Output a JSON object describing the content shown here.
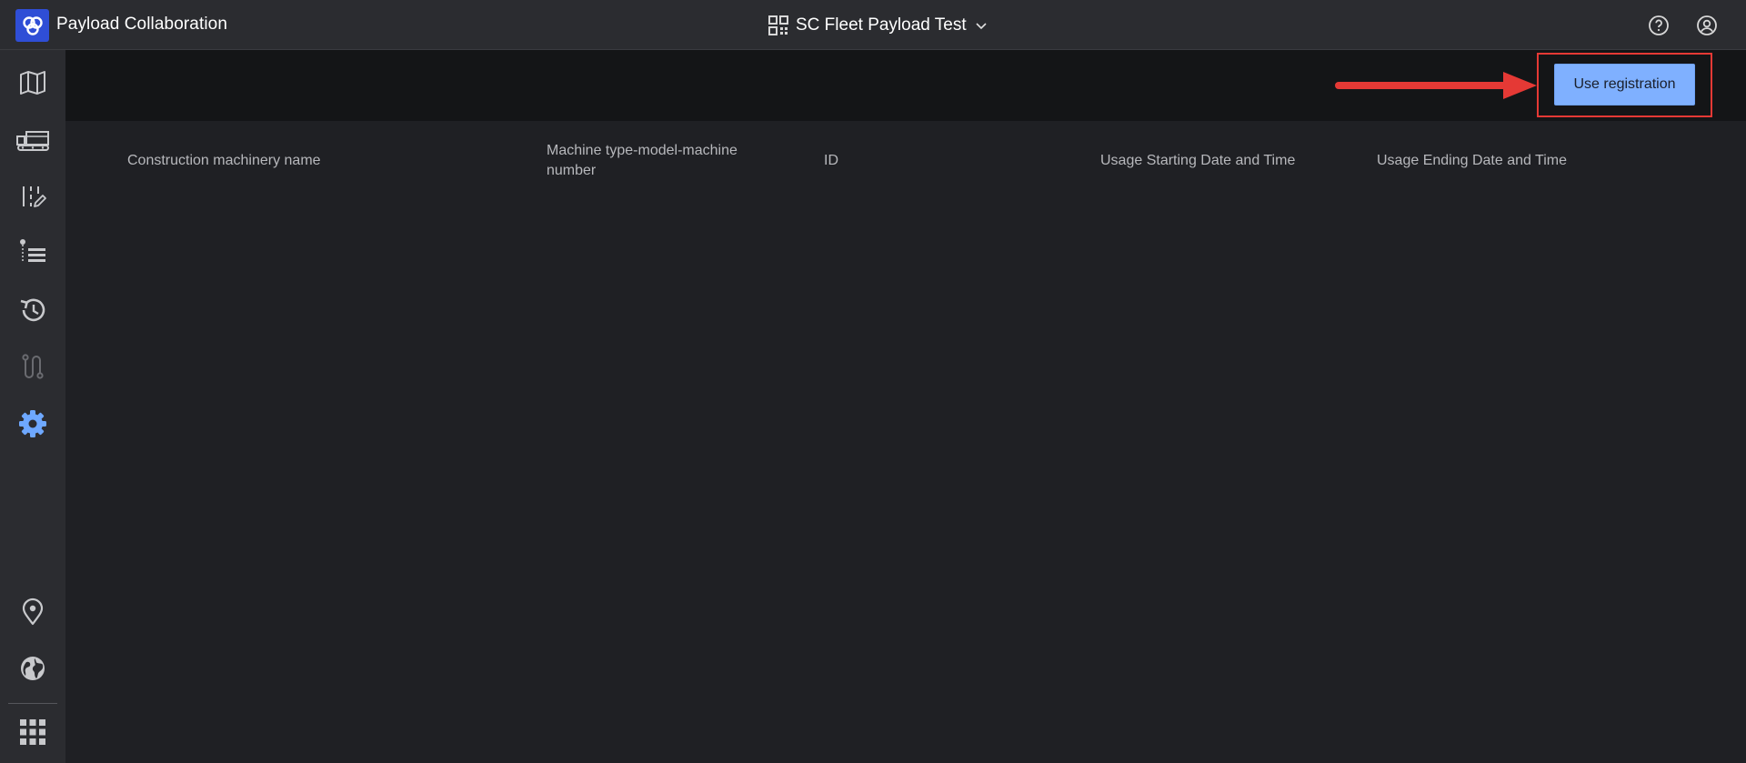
{
  "app": {
    "title": "Payload Collaboration"
  },
  "project": {
    "name": "SC Fleet Payload Test"
  },
  "actions": {
    "use_registration_label": "Use registration"
  },
  "table": {
    "columns": [
      "Construction machinery name",
      "Machine type-model-machine number",
      "ID",
      "Usage Starting Date and Time",
      "Usage Ending Date and Time"
    ]
  },
  "sidebar": {
    "items": [
      {
        "icon": "map-icon"
      },
      {
        "icon": "truck-icon"
      },
      {
        "icon": "layout-edit-icon"
      },
      {
        "icon": "tree-list-icon"
      },
      {
        "icon": "history-icon"
      },
      {
        "icon": "route-icon"
      },
      {
        "icon": "settings-gear-icon",
        "active": true
      },
      {
        "icon": "location-pin-icon"
      },
      {
        "icon": "globe-icon"
      },
      {
        "icon": "app-grid-icon"
      }
    ]
  },
  "colors": {
    "accent": "#7fb0ff",
    "active_icon": "#6ea8ff",
    "highlight": "#e53935",
    "logo_bg": "#2f4ed6"
  }
}
